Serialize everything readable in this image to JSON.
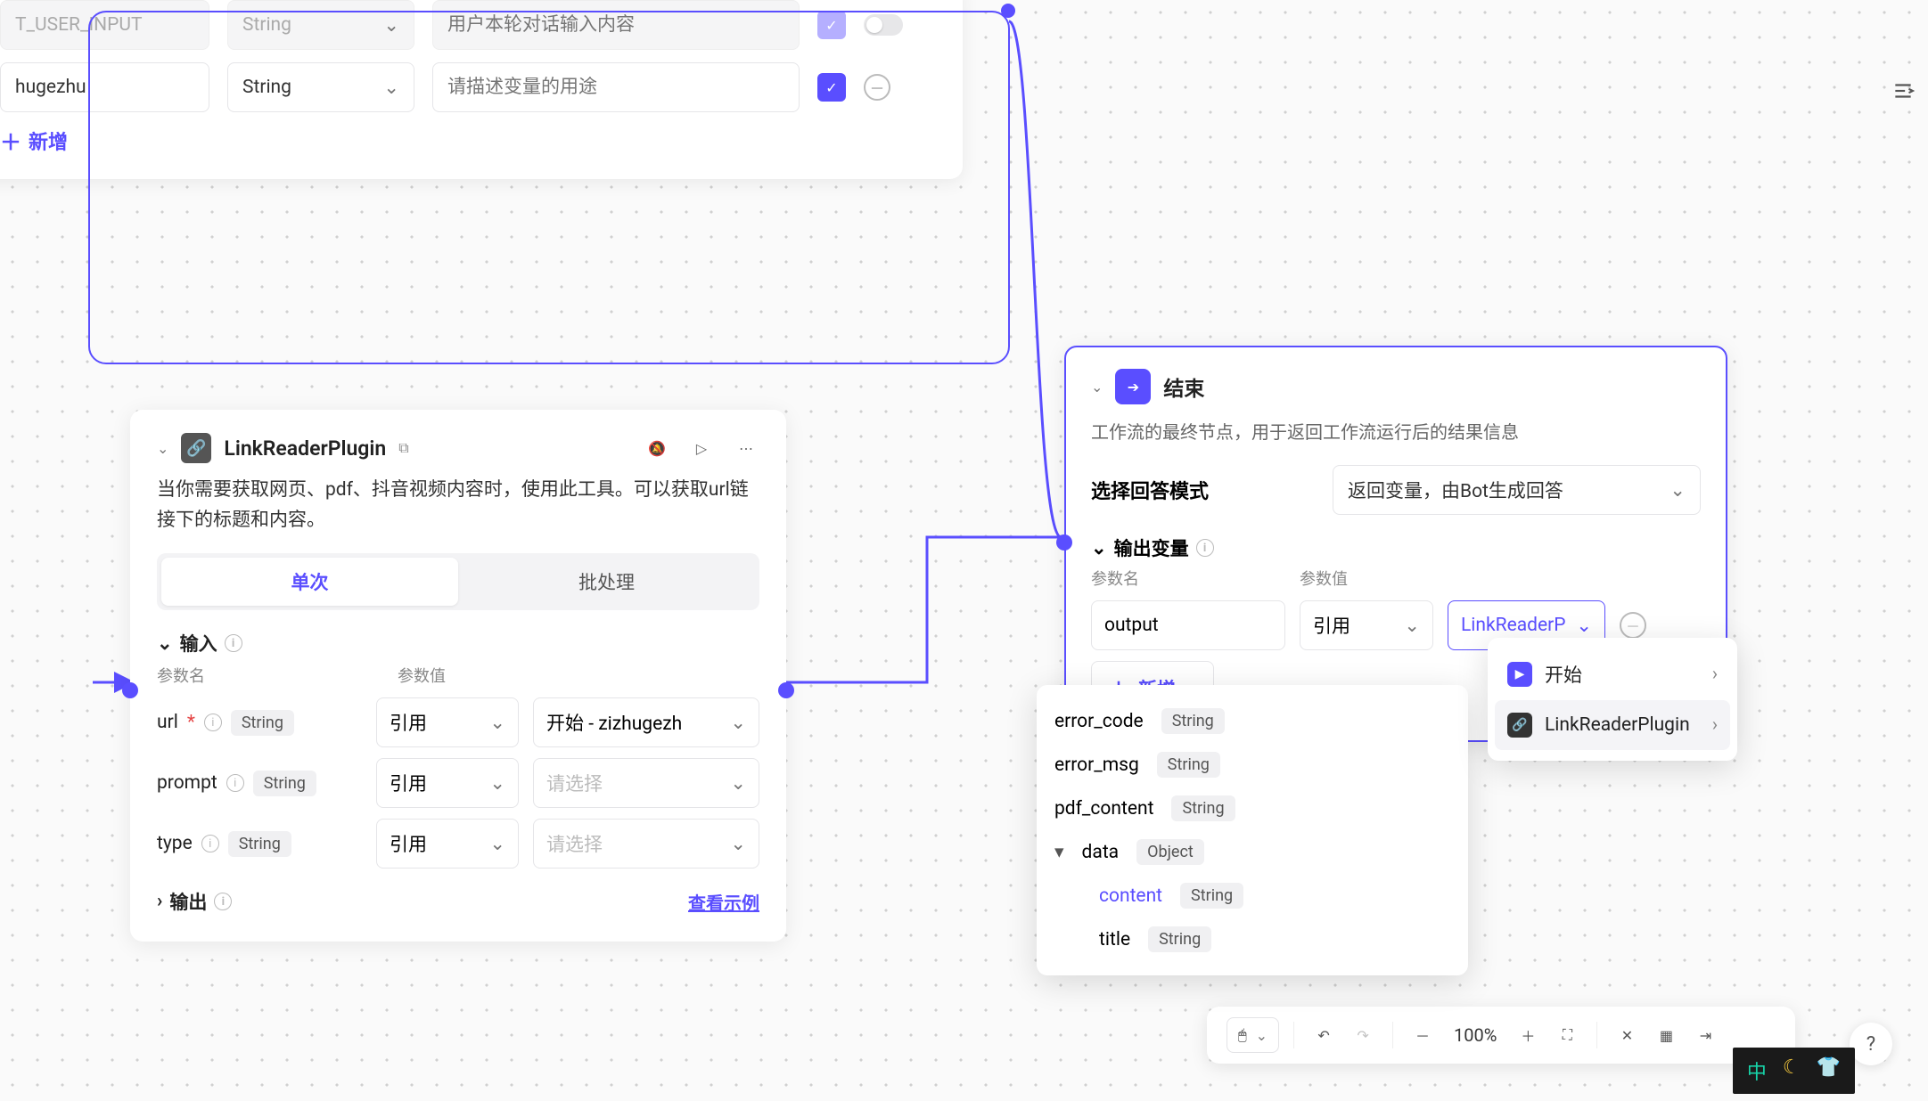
{
  "top_vars": {
    "row1": {
      "name": "T_USER_INPUT",
      "type": "String",
      "desc_placeholder": "用户本轮对话输入内容"
    },
    "row2": {
      "name": "hugezhu",
      "type": "String",
      "desc_placeholder": "请描述变量的用途"
    },
    "add_label": "新增"
  },
  "link_node": {
    "title": "LinkReaderPlugin",
    "desc": "当你需要获取网页、pdf、抖音视频内容时，使用此工具。可以获取url链接下的标题和内容。",
    "tabs": {
      "single": "单次",
      "batch": "批处理"
    },
    "input_section": "输入",
    "col_name": "参数名",
    "col_value": "参数值",
    "params": [
      {
        "name": "url",
        "type": "String",
        "required": true,
        "mode": "引用",
        "value": "开始 - zizhugezh"
      },
      {
        "name": "prompt",
        "type": "String",
        "required": false,
        "mode": "引用",
        "value_placeholder": "请选择"
      },
      {
        "name": "type",
        "type": "String",
        "required": false,
        "mode": "引用",
        "value_placeholder": "请选择"
      }
    ],
    "output_section": "输出",
    "view_example": "查看示例"
  },
  "end_node": {
    "title": "结束",
    "desc": "工作流的最终节点，用于返回工作流运行后的结果信息",
    "mode_label": "选择回答模式",
    "mode_value": "返回变量，由Bot生成回答",
    "out_section": "输出变量",
    "col_name": "参数名",
    "col_value": "参数值",
    "out_var": {
      "name": "output",
      "mode": "引用",
      "source": "LinkReaderP"
    },
    "add_label": "新增"
  },
  "dd_panel": {
    "items": [
      {
        "label": "开始",
        "icon": "light"
      },
      {
        "label": "LinkReaderPlugin",
        "icon": "dark"
      }
    ]
  },
  "fields_panel": {
    "items": [
      {
        "name": "error_code",
        "type": "String"
      },
      {
        "name": "error_msg",
        "type": "String"
      },
      {
        "name": "pdf_content",
        "type": "String"
      },
      {
        "name": "data",
        "type": "Object",
        "expanded": true,
        "children": [
          {
            "name": "content",
            "type": "String",
            "selected": true
          },
          {
            "name": "title",
            "type": "String"
          }
        ]
      }
    ]
  },
  "bottom_bar": {
    "mouse_label": "0",
    "zoom": "100%"
  },
  "ime": {
    "cn": "中"
  }
}
